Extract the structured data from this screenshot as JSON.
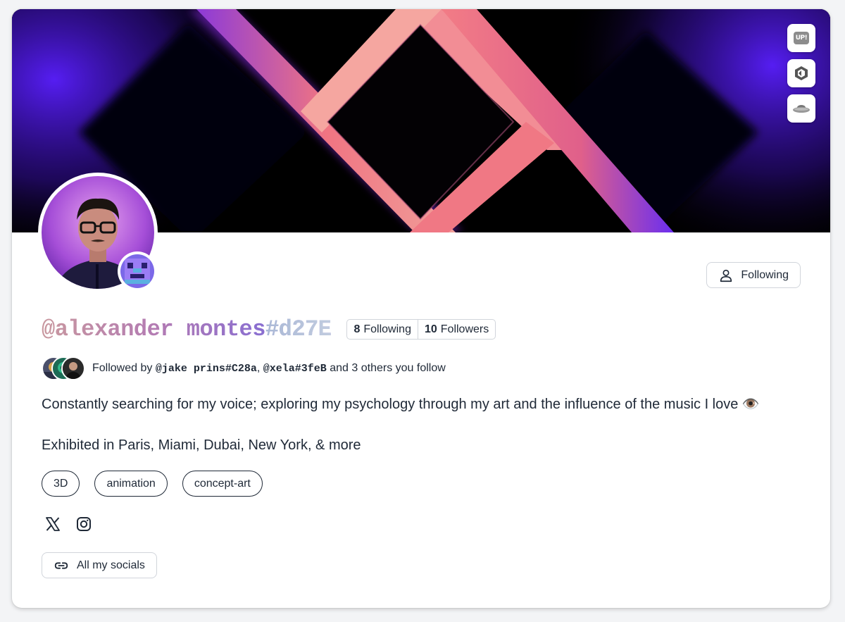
{
  "profile": {
    "handle": "@alexander montes",
    "tag": "#d27E",
    "following_count": "8",
    "following_label": "Following",
    "followers_count": "10",
    "followers_label": "Followers",
    "follow_button_label": "Following"
  },
  "followed_by": {
    "prefix": "Followed by",
    "users": [
      "@jake prins#C28a",
      "@xela#3feB"
    ],
    "separator": ",",
    "suffix": "and 3 others you follow"
  },
  "bio": {
    "line1": "Constantly searching for my voice; exploring my psychology through my art and the influence of the music I love 👁️",
    "line2": "Exhibited in Paris, Miami, Dubai, New York, & more"
  },
  "tags": [
    "3D",
    "animation",
    "concept-art"
  ],
  "side_badges": {
    "up_label": "UP!",
    "icons": [
      "up-badge-icon",
      "unity-icon",
      "flying-saucer-icon"
    ]
  },
  "socials": {
    "icons": [
      "x-twitter-icon",
      "instagram-icon"
    ],
    "all_socials_label": "All my socials"
  },
  "colors": {
    "banner_pink": "#ef6f7c",
    "banner_purple": "#4a14ff",
    "handle_gradient_start": "#c9989f",
    "handle_gradient_end": "#8b6fd0",
    "tag_color": "#aab9d6"
  }
}
